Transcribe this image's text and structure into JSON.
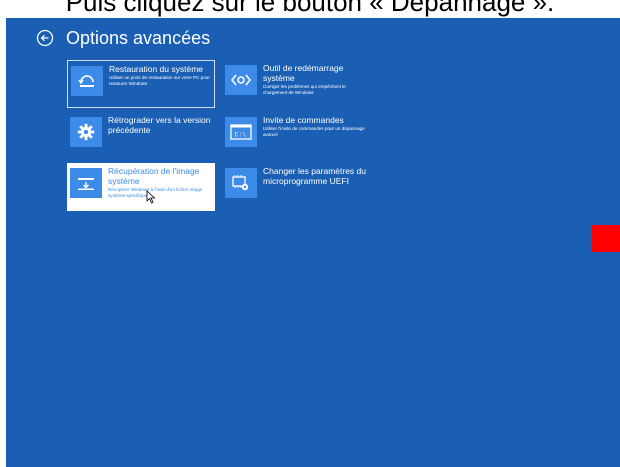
{
  "caption": "Puis cliquez sur le bouton « Dépannage ».",
  "header": {
    "title": "Options avancées"
  },
  "tiles": [
    {
      "title": "Restauration du système",
      "desc": "Utiliser un point de restauration sur votre PC pour restaurer Windows"
    },
    {
      "title": "Outil de redémarrage système",
      "desc": "Corriger les problèmes qui empêchent le chargement de Windows"
    },
    {
      "title": "Rétrograder vers la version précédente",
      "desc": ""
    },
    {
      "title": "Invite de commandes",
      "desc": "Utiliser l'invite de commandes pour un dépannage avancé"
    },
    {
      "title": "Récupération de l'image système",
      "desc": "Récupérer Windows à l'aide d'un fichier image système spécifique"
    },
    {
      "title": "Changer les paramètres du microprogramme UEFI",
      "desc": ""
    }
  ],
  "icons": {
    "back": "back-arrow-icon",
    "restore": "system-restore-icon",
    "startup": "startup-repair-icon",
    "rollback": "gear-icon",
    "cmd": "command-prompt-icon",
    "image": "system-image-icon",
    "uefi": "uefi-settings-icon"
  },
  "colors": {
    "background": "#1a5fb4",
    "tile_icon": "#3d8be8",
    "selected_tile": "#ffffff",
    "marker": "#ff0000"
  }
}
